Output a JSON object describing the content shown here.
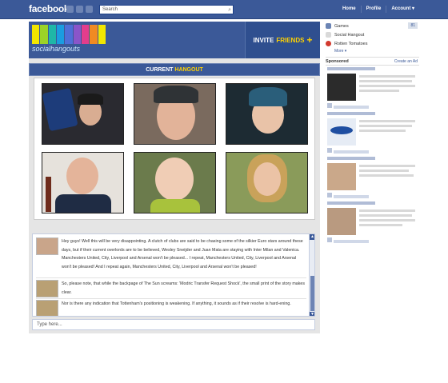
{
  "topbar": {
    "logo": "facebook",
    "search_placeholder": "Search",
    "nav": [
      "Home",
      "Profile",
      "Account ▾"
    ]
  },
  "banner": {
    "logo_text": "socialhangouts",
    "invite_prefix": "INVITE",
    "invite_highlight": "FRIENDS",
    "invite_plus": "+",
    "stripe_colors": [
      "#f2e600",
      "#9bd327",
      "#1fb7a7",
      "#1a9de0",
      "#4f6fd8",
      "#8a55c9",
      "#e33d8c",
      "#f08a22",
      "#f2e600"
    ]
  },
  "hangout_bar": {
    "prefix": "CURRENT",
    "highlight": "HANGOUT"
  },
  "chat": {
    "messages": [
      {
        "text": "Hey guys! Well this will be very disappointing. A clutch of clubs are said to be chasing some of the silkier Euro stars around these days, but if their current overlords are to be believed, Wesley Sneijder and Juan Mata are staying with Inter Milan and Valenica. Manchesters United, City, Liverpool and Arsenal won't be pleased... I repeat, Manchesters United, City, Liverpool and Arsenal won't be pleased! And I repeat again, Manchesters United, City, Liverpool and Arsenal won't be pleased!"
      },
      {
        "text": "So, please note, that while the backpage of The Sun screams: 'Modric Transfer Request Shock', the small print of the story makes clear."
      },
      {
        "text": "Nor is there any indication that Tottenham's positioning is weakening. If anything, it sounds as if their resolve is hard-ening."
      }
    ],
    "input_placeholder": "Type here..."
  },
  "sidebar": {
    "apps": [
      {
        "label": "Games",
        "badge": "81",
        "icon_color": "#6b84b4"
      },
      {
        "label": "Social Hangout",
        "badge": "",
        "icon_color": "#d9d9d9"
      },
      {
        "label": "Rotten Tomatoes",
        "badge": "",
        "icon_color": "#d23a2e"
      }
    ],
    "more_label": "More ▾",
    "sponsored_label": "Sponsored",
    "create_ad_label": "Create an Ad"
  }
}
